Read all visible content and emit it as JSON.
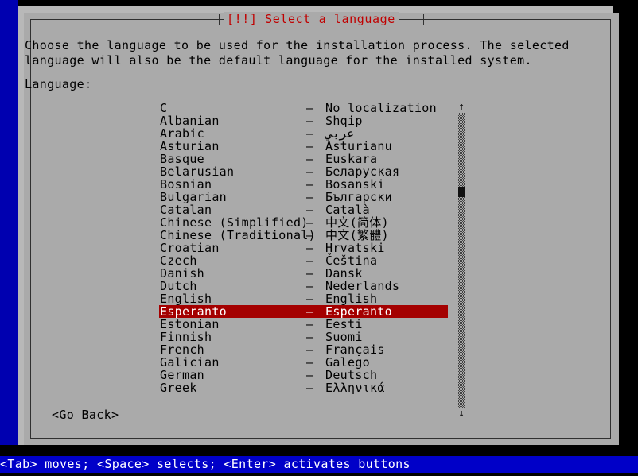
{
  "theme": {
    "desktop_blue": "#0000b0",
    "dialog_gray": "#aaaaaa",
    "title_red": "#c00000",
    "highlight_red": "#a40000",
    "statusbar_blue": "#0000c8",
    "text_black": "#000000",
    "text_white": "#ffffff"
  },
  "dialog": {
    "title": "[!!] Select a language",
    "description": "Choose the language to be used for the installation process. The selected language will also be the default language for the installed system.",
    "language_label": "Language:",
    "go_back_label": "<Go Back>"
  },
  "scrollbar": {
    "up_arrow": "↑",
    "down_arrow": "↓",
    "thumb_position_percent": 26
  },
  "list": {
    "separator": "–",
    "selected_index": 16,
    "items": [
      {
        "name": "C",
        "native": "No localization"
      },
      {
        "name": "Albanian",
        "native": "Shqip"
      },
      {
        "name": "Arabic",
        "native": "عربي"
      },
      {
        "name": "Asturian",
        "native": "Asturianu"
      },
      {
        "name": "Basque",
        "native": "Euskara"
      },
      {
        "name": "Belarusian",
        "native": "Беларуская"
      },
      {
        "name": "Bosnian",
        "native": "Bosanski"
      },
      {
        "name": "Bulgarian",
        "native": "Български"
      },
      {
        "name": "Catalan",
        "native": "Català"
      },
      {
        "name": "Chinese (Simplified)",
        "native": "中文(简体)"
      },
      {
        "name": "Chinese (Traditional)",
        "native": "中文(繁體)"
      },
      {
        "name": "Croatian",
        "native": "Hrvatski"
      },
      {
        "name": "Czech",
        "native": "Čeština"
      },
      {
        "name": "Danish",
        "native": "Dansk"
      },
      {
        "name": "Dutch",
        "native": "Nederlands"
      },
      {
        "name": "English",
        "native": "English"
      },
      {
        "name": "Esperanto",
        "native": "Esperanto"
      },
      {
        "name": "Estonian",
        "native": "Eesti"
      },
      {
        "name": "Finnish",
        "native": "Suomi"
      },
      {
        "name": "French",
        "native": "Français"
      },
      {
        "name": "Galician",
        "native": "Galego"
      },
      {
        "name": "German",
        "native": "Deutsch"
      },
      {
        "name": "Greek",
        "native": "Ελληνικά"
      }
    ]
  },
  "status_bar": {
    "text": "<Tab> moves; <Space> selects; <Enter> activates buttons"
  }
}
